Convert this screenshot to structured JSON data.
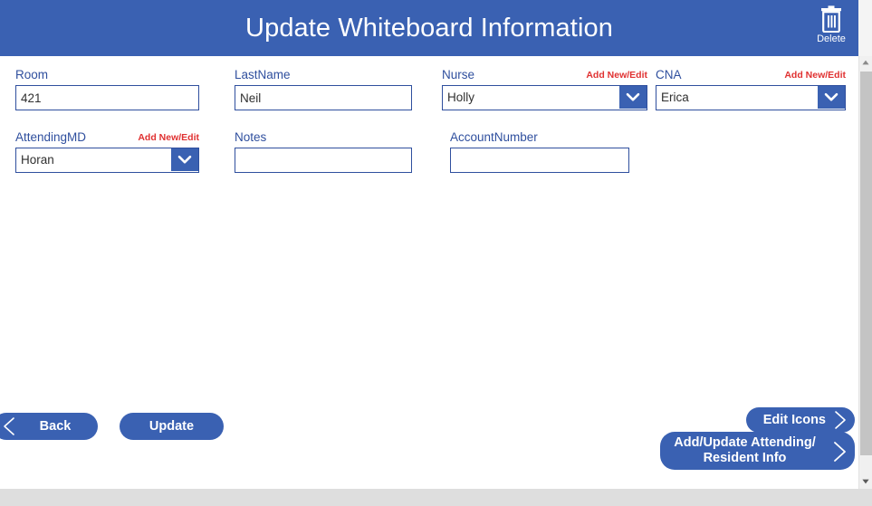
{
  "header": {
    "title": "Update Whiteboard Information",
    "delete_label": "Delete",
    "delete_icon": "trash-icon",
    "background_color": "#3a61b2"
  },
  "colors": {
    "accent_blue": "#3a61b2",
    "label_blue": "#2f4f9e",
    "link_red": "#e03131",
    "field_border": "#2f4f9e",
    "footer_gray": "#dedede",
    "scrollbar_track": "#f0f0f0",
    "scrollbar_thumb": "#c4c4c4"
  },
  "form": {
    "add_new_edit_label": "Add New/Edit",
    "fields": [
      {
        "name": "Room",
        "label": "Room",
        "type": "text",
        "value": "421",
        "placeholder": "",
        "has_add_new_edit": false
      },
      {
        "name": "LastName",
        "label": "LastName",
        "type": "text",
        "value": "Neil",
        "placeholder": "",
        "has_add_new_edit": false
      },
      {
        "name": "Nurse",
        "label": "Nurse",
        "type": "dropdown",
        "value": "Holly",
        "placeholder": "",
        "has_add_new_edit": true
      },
      {
        "name": "CNA",
        "label": "CNA",
        "type": "dropdown",
        "value": "Erica",
        "placeholder": "",
        "has_add_new_edit": true
      },
      {
        "name": "AttendingMD",
        "label": "AttendingMD",
        "type": "dropdown",
        "value": "Horan",
        "placeholder": "",
        "has_add_new_edit": true
      },
      {
        "name": "Notes",
        "label": "Notes",
        "type": "text",
        "value": "",
        "placeholder": "",
        "has_add_new_edit": false
      },
      {
        "name": "AccountNumber",
        "label": "AccountNumber",
        "type": "text",
        "value": "",
        "placeholder": "",
        "has_add_new_edit": false
      }
    ]
  },
  "buttons": {
    "back": "Back",
    "update": "Update",
    "edit_icons": "Edit Icons",
    "add_update_attending_line1": "Add/Update Attending/",
    "add_update_attending_line2": "Resident Info"
  },
  "scrollbar": {
    "up_arrow_icon": "caret-up-icon",
    "down_arrow_icon": "caret-down-icon",
    "orientation": "vertical"
  }
}
